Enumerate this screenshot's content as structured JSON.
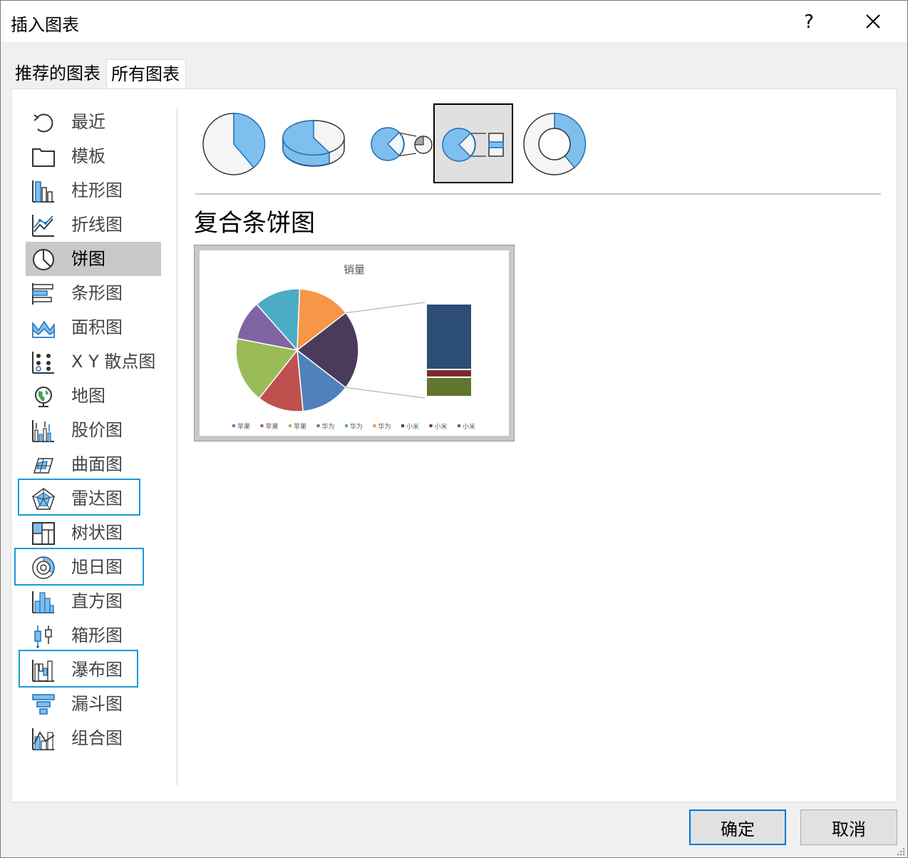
{
  "dialog": {
    "title": "插入图表",
    "help_label": "?",
    "ok_label": "确定",
    "cancel_label": "取消"
  },
  "tabs": [
    {
      "label": "推荐的图表",
      "active": false
    },
    {
      "label": "所有图表",
      "active": true
    }
  ],
  "sidebar": {
    "items": [
      {
        "label": "最近",
        "icon": "recent-icon"
      },
      {
        "label": "模板",
        "icon": "template-icon"
      },
      {
        "label": "柱形图",
        "icon": "column-chart-icon"
      },
      {
        "label": "折线图",
        "icon": "line-chart-icon"
      },
      {
        "label": "饼图",
        "icon": "pie-chart-icon",
        "selected": true
      },
      {
        "label": "条形图",
        "icon": "bar-chart-icon"
      },
      {
        "label": "面积图",
        "icon": "area-chart-icon"
      },
      {
        "label": "X Y 散点图",
        "icon": "scatter-chart-icon"
      },
      {
        "label": "地图",
        "icon": "map-chart-icon"
      },
      {
        "label": "股价图",
        "icon": "stock-chart-icon"
      },
      {
        "label": "曲面图",
        "icon": "surface-chart-icon"
      },
      {
        "label": "雷达图",
        "icon": "radar-chart-icon",
        "highlighted": true
      },
      {
        "label": "树状图",
        "icon": "treemap-chart-icon"
      },
      {
        "label": "旭日图",
        "icon": "sunburst-chart-icon",
        "highlighted": true
      },
      {
        "label": "直方图",
        "icon": "histogram-chart-icon"
      },
      {
        "label": "箱形图",
        "icon": "box-whisker-chart-icon"
      },
      {
        "label": "瀑布图",
        "icon": "waterfall-chart-icon",
        "highlighted": true
      },
      {
        "label": "漏斗图",
        "icon": "funnel-chart-icon"
      },
      {
        "label": "组合图",
        "icon": "combo-chart-icon"
      }
    ]
  },
  "subtypes": [
    {
      "icon": "pie-icon"
    },
    {
      "icon": "3d-pie-icon"
    },
    {
      "icon": "pie-of-pie-icon"
    },
    {
      "icon": "bar-of-pie-icon",
      "selected": true
    },
    {
      "icon": "doughnut-icon"
    }
  ],
  "selected_subtype_name": "复合条饼图",
  "colors": {
    "accent": "#0078d7",
    "highlight": "#1a9ad9",
    "icon_blue": "#7fbfee",
    "icon_stroke": "#1d6fb8"
  },
  "chart_data": {
    "type": "pie",
    "title": "销量",
    "categories": [
      "苹果",
      "苹果",
      "苹果",
      "华为",
      "华为",
      "华为",
      "小米",
      "小米",
      "小米"
    ],
    "values": [
      15,
      14,
      20,
      12,
      14,
      16,
      17,
      2,
      5
    ],
    "colors": [
      "#4f81bd",
      "#c0504d",
      "#9bbb59",
      "#8064a2",
      "#4bacc6",
      "#f79646",
      "#2c4d75",
      "#772c2a",
      "#5f7530"
    ],
    "secondary_plot": "bar",
    "legend_position": "bottom"
  }
}
